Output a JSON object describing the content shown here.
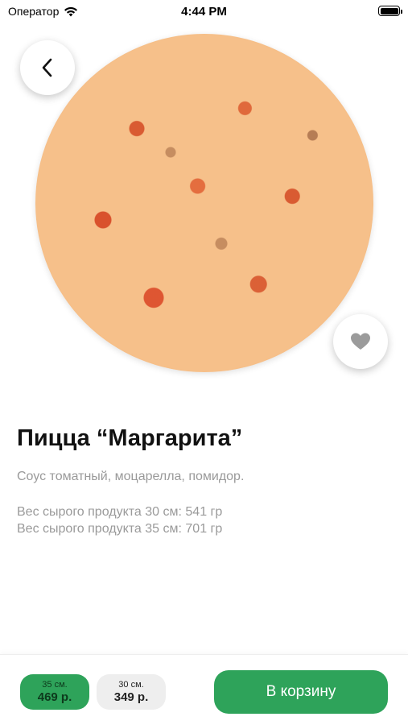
{
  "status_bar": {
    "carrier": "Оператор",
    "time": "4:44 PM"
  },
  "hero": {
    "back_icon": "chevron-left-icon",
    "favorite_icon": "heart-icon"
  },
  "product": {
    "title": "Пицца “Маргарита”",
    "ingredients": "Соус томатный, моцарелла, помидор.",
    "weights": [
      "Вес сырого продукта 30 см: 541 гр",
      "Вес сырого продукта 35 см: 701 гр"
    ]
  },
  "bottom_bar": {
    "sizes": [
      {
        "size": "35 см.",
        "price": "469 р.",
        "selected": true
      },
      {
        "size": "30 см.",
        "price": "349 р.",
        "selected": false
      }
    ],
    "cart_label": "В корзину"
  },
  "colors": {
    "accent": "#2ea35a",
    "muted_text": "#9a9a9a",
    "inactive_chip": "#eeeeee"
  }
}
